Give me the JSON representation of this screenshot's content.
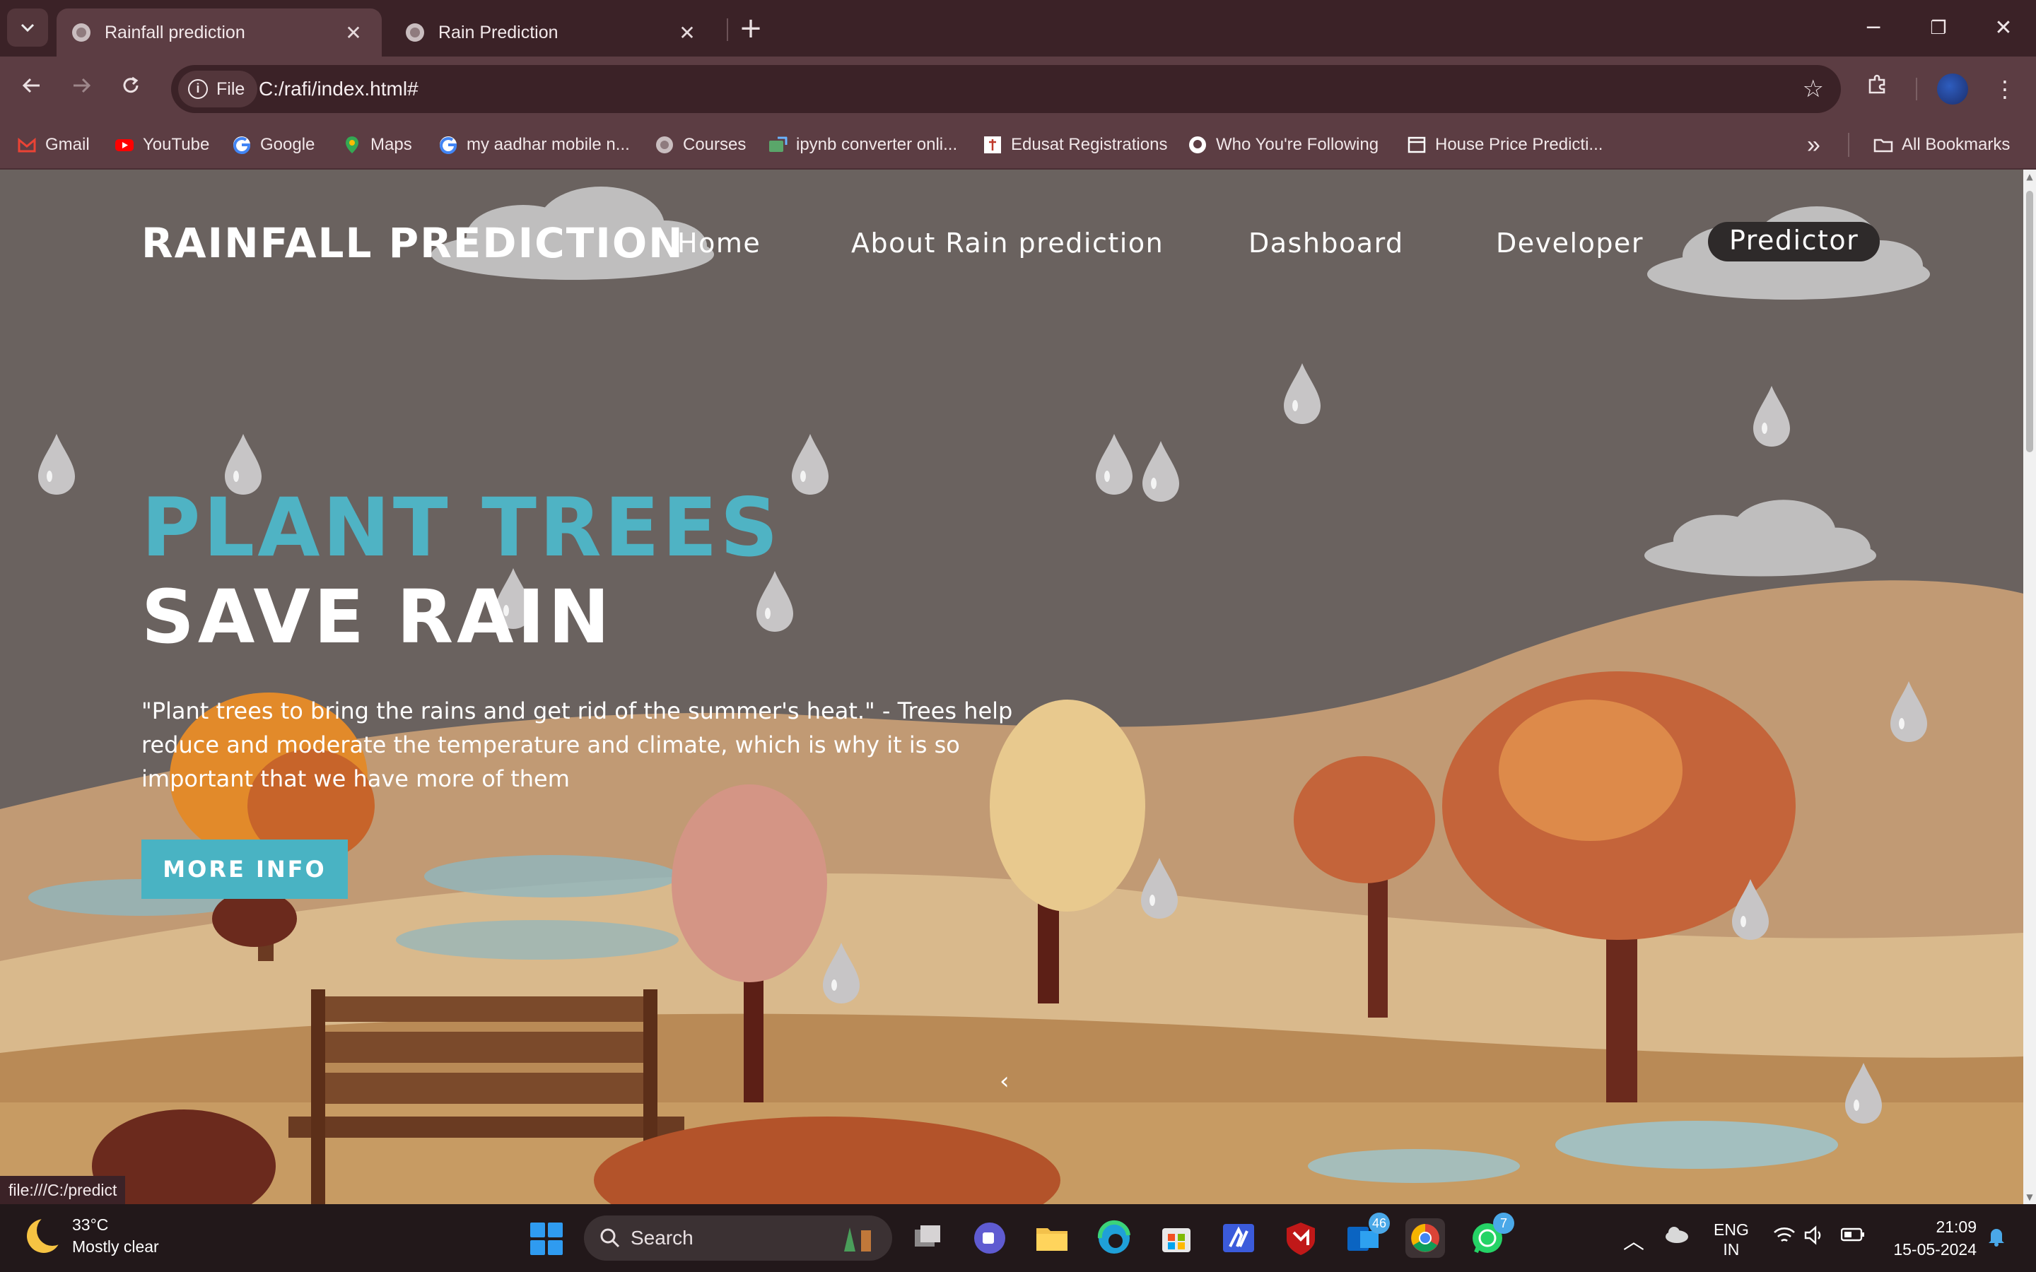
{
  "browser": {
    "tabs": [
      {
        "title": "Rainfall prediction",
        "active": true,
        "close": "✕"
      },
      {
        "title": "Rain Prediction",
        "active": false,
        "close": "✕"
      }
    ],
    "new_tab_label": "+",
    "window_controls": {
      "minimize": "─",
      "restore": "❐",
      "close": "✕"
    },
    "site_chip_label": "File",
    "url": "C:/rafi/index.html#",
    "bookmarks": [
      {
        "label": "Gmail",
        "icon": "gmail-icon",
        "color": "#ea4335"
      },
      {
        "label": "YouTube",
        "icon": "youtube-icon",
        "color": "#ff0000"
      },
      {
        "label": "Google",
        "icon": "google-icon",
        "color": "#4285f4"
      },
      {
        "label": "Maps",
        "icon": "maps-icon",
        "color": "#34a853"
      },
      {
        "label": "my aadhar mobile n...",
        "icon": "google-icon",
        "color": "#4285f4"
      },
      {
        "label": "Courses",
        "icon": "globe-icon",
        "color": "#9c8a8d"
      },
      {
        "label": "ipynb converter onli...",
        "icon": "converter-icon",
        "color": "#5aa66a"
      },
      {
        "label": "Edusat Registrations",
        "icon": "edusat-icon",
        "color": "#ffffff"
      },
      {
        "label": "Who You're Following",
        "icon": "github-icon",
        "color": "#ffffff"
      },
      {
        "label": "House Price Predicti...",
        "icon": "page-icon",
        "color": "#ffffff"
      }
    ],
    "more_bookmarks": "»",
    "all_bookmarks_label": "All Bookmarks",
    "status_url": "file:///C:/predict"
  },
  "page": {
    "brand": "RAINFALL PREDICTION",
    "nav": [
      {
        "label": "Home"
      },
      {
        "label": "About Rain prediction"
      },
      {
        "label": "Dashboard"
      },
      {
        "label": "Developer"
      },
      {
        "label": "Predictor"
      }
    ],
    "hero_title_1": "PLANT TREES",
    "hero_title_2": "SAVE RAIN",
    "hero_text": "\"Plant trees to bring the rains and get rid of the summer's heat.\" - Trees help reduce and moderate the temperature and climate, which is why it is so important that we have more of them",
    "cta_label": "MORE INFO",
    "carousel_prev": "‹",
    "colors": {
      "accent": "#4fb3c4",
      "button": "#49b3c3",
      "sky": "#6a625f"
    }
  },
  "taskbar": {
    "weather_temp": "33°C",
    "weather_desc": "Mostly clear",
    "search_placeholder": "Search",
    "badge_outlook": "46",
    "badge_whatsapp": "7",
    "language_top": "ENG",
    "language_bottom": "IN",
    "time": "21:09",
    "date": "15-05-2024"
  }
}
